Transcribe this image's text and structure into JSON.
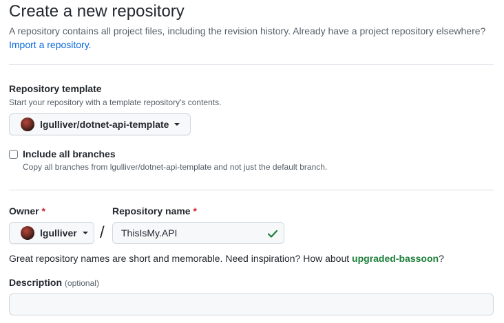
{
  "header": {
    "title": "Create a new repository",
    "subtitle": "A repository contains all project files, including the revision history. Already have a project repository elsewhere?",
    "import_link": "Import a repository",
    "import_link_suffix": "."
  },
  "template": {
    "label": "Repository template",
    "note": "Start your repository with a template repository's contents.",
    "selected": "lgulliver/dotnet-api-template",
    "avatar_icon": "avatar-icon"
  },
  "branches": {
    "checkbox_label": "Include all branches",
    "checked": false,
    "note": "Copy all branches from lgulliver/dotnet-api-template and not just the default branch."
  },
  "owner": {
    "label": "Owner",
    "required_mark": "*",
    "selected": "lgulliver"
  },
  "separator": "/",
  "repo_name": {
    "label": "Repository name",
    "required_mark": "*",
    "value": "ThisIsMy.API",
    "valid_icon": "check-icon",
    "valid_color": "#1a7f37"
  },
  "name_hint": {
    "prefix": "Great repository names are short and memorable. Need inspiration? How about ",
    "suggestion": "upgraded-bassoon",
    "suffix": "?"
  },
  "description": {
    "label": "Description",
    "optional": "(optional)",
    "value": ""
  },
  "colors": {
    "link": "#0969da",
    "required": "#cf222e",
    "suggestion": "#1a7f37"
  }
}
